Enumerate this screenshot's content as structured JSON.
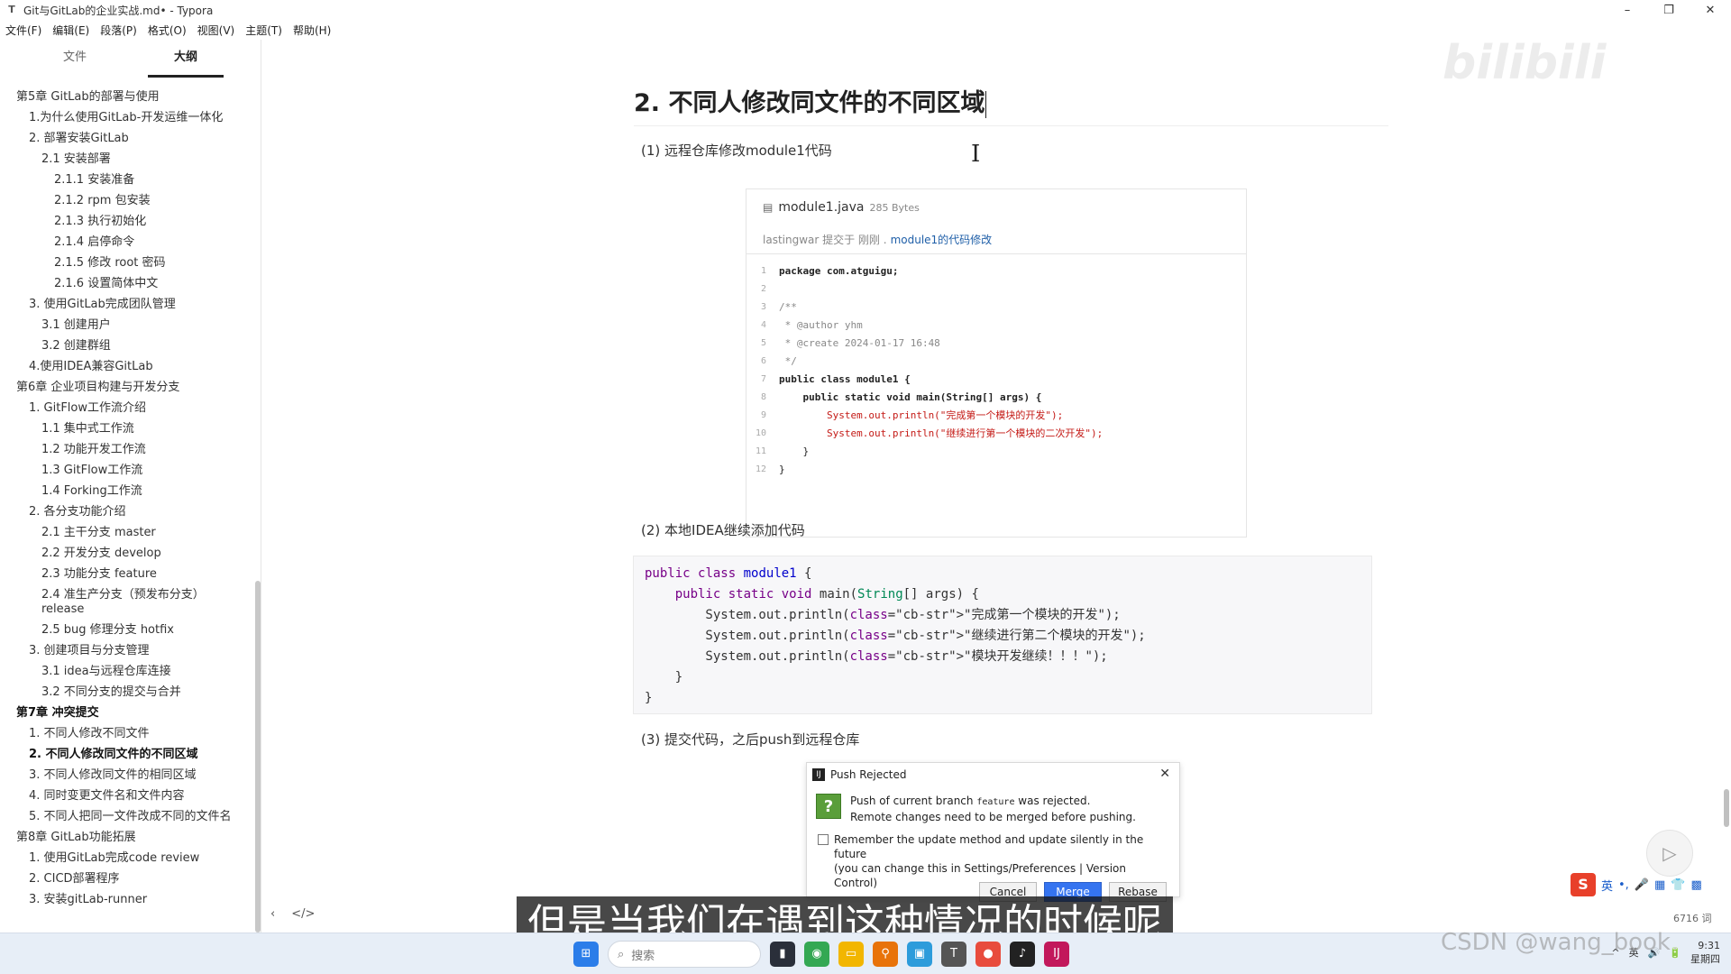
{
  "window": {
    "title": "Git与GitLab的企业实战.md• - Typora",
    "minimize": "–",
    "maximize": "❐",
    "close": "✕"
  },
  "menu": [
    "文件(F)",
    "编辑(E)",
    "段落(P)",
    "格式(O)",
    "视图(V)",
    "主题(T)",
    "帮助(H)"
  ],
  "sidebar": {
    "tabs": [
      "文件",
      "大纲"
    ],
    "outline": [
      {
        "label": "第5章 GitLab的部署与使用",
        "level": 1
      },
      {
        "label": "1.为什么使用GitLab-开发运维一体化",
        "level": 2
      },
      {
        "label": "2. 部署安装GitLab",
        "level": 2
      },
      {
        "label": "2.1 安装部署",
        "level": 3
      },
      {
        "label": "2.1.1 安装准备",
        "level": 4
      },
      {
        "label": "2.1.2 rpm 包安装",
        "level": 4
      },
      {
        "label": "2.1.3 执行初始化",
        "level": 4
      },
      {
        "label": "2.1.4 启停命令",
        "level": 4
      },
      {
        "label": "2.1.5 修改 root 密码",
        "level": 4
      },
      {
        "label": "2.1.6 设置简体中文",
        "level": 4
      },
      {
        "label": "3. 使用GitLab完成团队管理",
        "level": 2
      },
      {
        "label": "3.1 创建用户",
        "level": 3
      },
      {
        "label": "3.2 创建群组",
        "level": 3
      },
      {
        "label": "4.使用IDEA兼容GitLab",
        "level": 2
      },
      {
        "label": "第6章 企业项目构建与开发分支",
        "level": 1
      },
      {
        "label": "1. GitFlow工作流介绍",
        "level": 2
      },
      {
        "label": "1.1 集中式工作流",
        "level": 3
      },
      {
        "label": "1.2 功能开发工作流",
        "level": 3
      },
      {
        "label": "1.3 GitFlow工作流",
        "level": 3
      },
      {
        "label": "1.4 Forking工作流",
        "level": 3
      },
      {
        "label": "2. 各分支功能介绍",
        "level": 2
      },
      {
        "label": "2.1 主干分支 master",
        "level": 3
      },
      {
        "label": "2.2 开发分支 develop",
        "level": 3
      },
      {
        "label": "2.3 功能分支 feature",
        "level": 3
      },
      {
        "label": "2.4 准生产分支（预发布分支）release",
        "level": 3,
        "wrap": true
      },
      {
        "label": "2.5 bug 修理分支 hotfix",
        "level": 3
      },
      {
        "label": "3. 创建项目与分支管理",
        "level": 2
      },
      {
        "label": "3.1 idea与远程仓库连接",
        "level": 3
      },
      {
        "label": "3.2 不同分支的提交与合并",
        "level": 3
      },
      {
        "label": "第7章 冲突提交",
        "level": 1,
        "bold": true
      },
      {
        "label": "1. 不同人修改不同文件",
        "level": 2
      },
      {
        "label": "2. 不同人修改同文件的不同区域",
        "level": 2,
        "bold": true
      },
      {
        "label": "3. 不同人修改同文件的相同区域",
        "level": 2
      },
      {
        "label": "4. 同时变更文件名和文件内容",
        "level": 2
      },
      {
        "label": "5. 不同人把同一文件改成不同的文件名",
        "level": 2,
        "wrap": true
      },
      {
        "label": "第8章 GitLab功能拓展",
        "level": 1
      },
      {
        "label": "1. 使用GitLab完成code review",
        "level": 2
      },
      {
        "label": "2. CICD部署程序",
        "level": 2
      },
      {
        "label": "3. 安装gitLab-runner",
        "level": 2
      }
    ],
    "footer": {
      "back": "‹",
      "source": "</>"
    }
  },
  "doc": {
    "heading": "2. 不同人修改同文件的不同区域",
    "step1": "(1)  远程仓库修改module1代码",
    "step2": "(2)  本地IDEA继续添加代码",
    "step3": "(3)  提交代码，之后push到远程仓库",
    "gitlab": {
      "file_icon": "▤",
      "filename": "module1.java",
      "size": "285 Bytes",
      "commit_prefix": "lastingwar 提交于 刚刚 .",
      "commit_msg": "module1的代码修改",
      "lines": [
        {
          "n": "1",
          "code": "package com.atguigu;",
          "cls": "kw"
        },
        {
          "n": "2",
          "code": "",
          "cls": ""
        },
        {
          "n": "3",
          "code": "/**",
          "cls": "cm"
        },
        {
          "n": "4",
          "code": " * @author yhm",
          "cls": "cm"
        },
        {
          "n": "5",
          "code": " * @create 2024-01-17 16:48",
          "cls": "cm"
        },
        {
          "n": "6",
          "code": " */",
          "cls": "cm"
        },
        {
          "n": "7",
          "code": "public class module1 {",
          "cls": "kw"
        },
        {
          "n": "8",
          "code": "    public static void main(String[] args) {",
          "cls": "kw"
        },
        {
          "n": "9",
          "code": "        System.out.println(\"完成第一个模块的开发\");",
          "cls": "str"
        },
        {
          "n": "10",
          "code": "        System.out.println(\"继续进行第一个模块的二次开发\");",
          "cls": "str"
        },
        {
          "n": "11",
          "code": "    }",
          "cls": ""
        },
        {
          "n": "12",
          "code": "}",
          "cls": ""
        }
      ]
    },
    "codeblock": [
      "public class module1 {",
      "    public static void main(String[] args) {",
      "        System.out.println(\"完成第一个模块的开发\");",
      "        System.out.println(\"继续进行第二个模块的开发\");",
      "        System.out.println(\"模块开发继续！！！\");",
      "    }",
      "}"
    ],
    "dialog": {
      "title": "Push Rejected",
      "close": "✕",
      "icon": "?",
      "msg1_a": "Push of current branch ",
      "msg1_branch": "feature",
      "msg1_b": " was rejected.",
      "msg2": "Remote changes need to be merged before pushing.",
      "check_line1": "Remember the update method and update silently in the future",
      "check_line2": "(you can change this in Settings/Preferences | Version Control)",
      "btn_cancel": "Cancel",
      "btn_merge": "Merge",
      "btn_rebase": "Rebase"
    }
  },
  "overlay": {
    "subtitle": "但是当我们在遇到这种情况的时候呢",
    "watermark_bili": "bilibili",
    "watermark_csdn": "CSDN @wang_book",
    "word_count": "6716 词",
    "play": "▷"
  },
  "ime": {
    "logo": "S",
    "items": [
      "英",
      "•,",
      "🎤",
      "▦",
      "👕",
      "▩"
    ]
  },
  "taskbar": {
    "search_placeholder": "搜索",
    "clock_time": "9:31",
    "clock_day": "星期四",
    "tray": [
      "^",
      "英",
      "🔊",
      "🔋"
    ]
  },
  "colors": {
    "accent": "#3574f0",
    "link": "#1f5fa8",
    "string": "#aa1111",
    "keyword": "#770088"
  }
}
